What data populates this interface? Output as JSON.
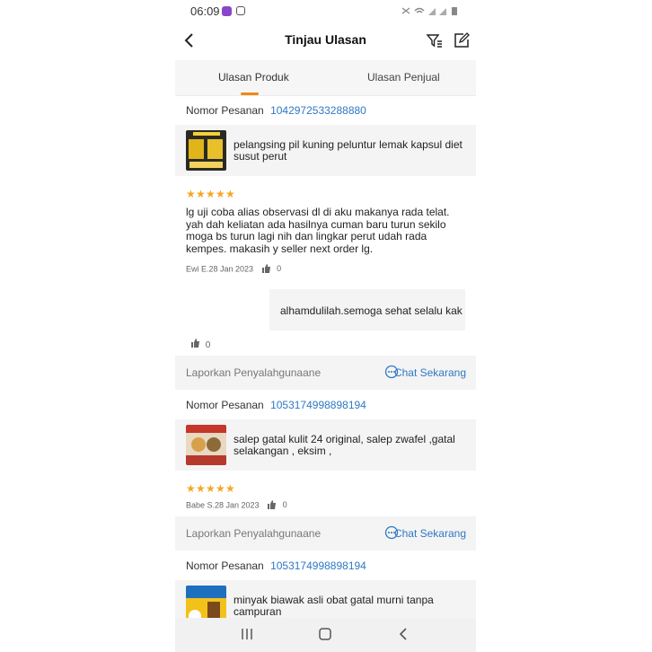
{
  "status_bar": {
    "time": "06:09"
  },
  "header": {
    "title": "Tinjau Ulasan"
  },
  "tabs": [
    {
      "label": "Ulasan Produk",
      "active": true
    },
    {
      "label": "Ulasan Penjual",
      "active": false
    }
  ],
  "orders": [
    {
      "order_label": "Nomor Pesanan",
      "order_number": "1042972533288880",
      "product_name": "pelangsing pil kuning peluntur lemak kapsul diet susut perut",
      "rating": 5,
      "review_text": "lg uji coba alias observasi dl di aku makanya rada telat. yah dah keliatan ada hasilnya cuman baru turun sekilo moga bs turun lagi nih dan lingkar perut udah rada kempes. makasih y seller next order lg.",
      "meta": "Ewi E.28 Jan 2023",
      "likes": "0",
      "seller_reply": "alhamdulilah.semoga sehat selalu kak",
      "reply_likes": "0"
    },
    {
      "order_label": "Nomor Pesanan",
      "order_number": "1053174998898194",
      "product_name": "salep gatal kulit 24 original, salep zwafel ,gatal selakangan , eksim ,",
      "rating": 5,
      "meta": "Babe S.28 Jan 2023",
      "likes": "0"
    },
    {
      "order_label": "Nomor Pesanan",
      "order_number": "1053174998898194",
      "product_name": "minyak biawak asli obat gatal murni tanpa campuran"
    }
  ],
  "actions": {
    "report": "Laporkan Penyalahgunaane",
    "chat": "Chat Sekarang"
  },
  "colors": {
    "accent": "#ee8a16",
    "link": "#2f78c4",
    "star": "#f5a623"
  }
}
